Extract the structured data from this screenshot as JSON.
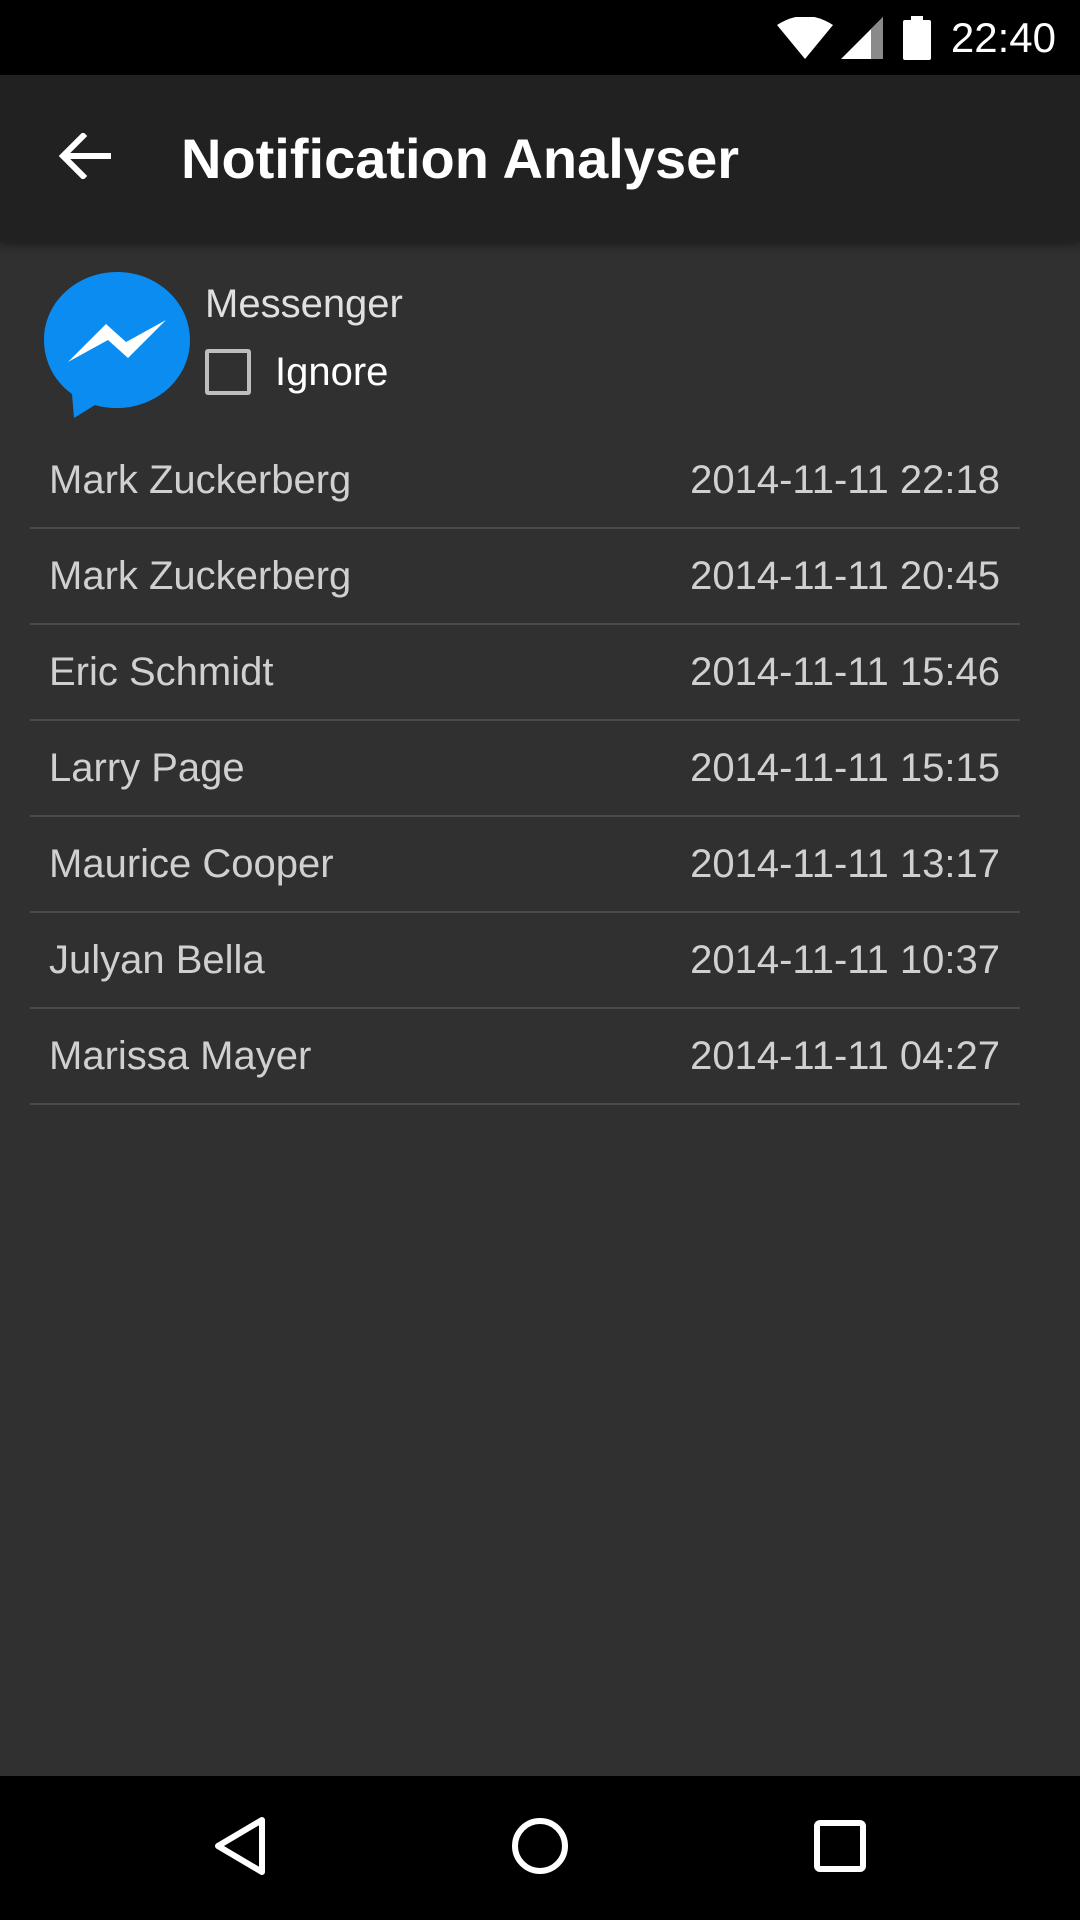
{
  "status_bar": {
    "time": "22:40",
    "icons": [
      "wifi-icon",
      "cell-signal-icon",
      "battery-icon"
    ]
  },
  "app_bar": {
    "title": "Notification Analyser",
    "back_icon": "arrow-back-icon"
  },
  "app_header": {
    "app_name": "Messenger",
    "app_icon": "messenger-icon",
    "ignore_label": "Ignore",
    "ignore_checked": false
  },
  "notifications": [
    {
      "sender": "Mark Zuckerberg",
      "timestamp": "2014-11-11 22:18"
    },
    {
      "sender": "Mark Zuckerberg",
      "timestamp": "2014-11-11 20:45"
    },
    {
      "sender": "Eric Schmidt",
      "timestamp": "2014-11-11 15:46"
    },
    {
      "sender": "Larry Page",
      "timestamp": "2014-11-11 15:15"
    },
    {
      "sender": "Maurice Cooper",
      "timestamp": "2014-11-11 13:17"
    },
    {
      "sender": "Julyan Bella",
      "timestamp": "2014-11-11 10:37"
    },
    {
      "sender": "Marissa Mayer",
      "timestamp": "2014-11-11 04:27"
    }
  ],
  "nav_bar": {
    "icons": [
      "back-triangle-icon",
      "home-circle-icon",
      "recents-square-icon"
    ]
  },
  "colors": {
    "background": "#303030",
    "app_bar": "#212121",
    "messenger_blue": "#0084ff",
    "divider": "#4a4a4a"
  }
}
